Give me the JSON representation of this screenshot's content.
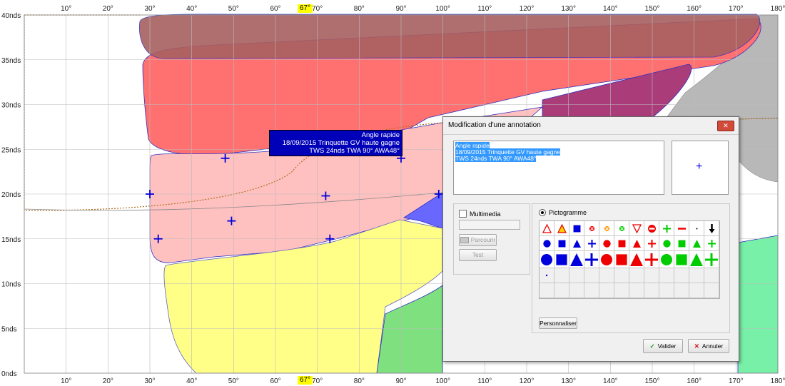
{
  "chart_data": {
    "type": "area",
    "x_ticks": [
      "10°",
      "20°",
      "30°",
      "40°",
      "50°",
      "60°",
      "70°",
      "80°",
      "90°",
      "100°",
      "110°",
      "120°",
      "130°",
      "140°",
      "150°",
      "160°",
      "170°",
      "180°"
    ],
    "y_ticks": [
      "0nds",
      "5nds",
      "10nds",
      "15nds",
      "20nds",
      "25nds",
      "30nds",
      "35nds",
      "40nds"
    ],
    "xlim": [
      0,
      180
    ],
    "ylim": [
      0,
      40
    ],
    "grid": true,
    "marker": {
      "label": "67°",
      "x": 67
    },
    "plus_points": [
      {
        "x": 48,
        "y": 24
      },
      {
        "x": 30,
        "y": 20
      },
      {
        "x": 72,
        "y": 19.8
      },
      {
        "x": 90,
        "y": 24
      },
      {
        "x": 49.5,
        "y": 17
      },
      {
        "x": 32,
        "y": 15
      },
      {
        "x": 73,
        "y": 15
      },
      {
        "x": 99,
        "y": 20
      }
    ],
    "colors": {
      "red": "#ff7070",
      "pink": "#ffc0c0",
      "yellow": "#ffff88",
      "green": "#78f0a8",
      "lime": "#7fe07f",
      "blue": "#6868ff",
      "purple": "#aa3c7a",
      "brown": "#a86060",
      "gray": "#b8b8b8"
    }
  },
  "tooltip": {
    "lines": [
      "Angle rapide",
      "18/09/2015 Trinquette GV haute gagne",
      "TWS 24nds TWA 90° AWA48°"
    ]
  },
  "dialog": {
    "title": "Modification d'une annotation",
    "close_label": "✕",
    "text_lines": [
      "Angle rapide",
      "18/09/2015 Trinquette GV haute gagne",
      "TWS 24nds TWA 90° AWA48°"
    ],
    "preview_symbol": "+",
    "multimedia_label": "Multimedia",
    "parcourir_label": "Parcourir",
    "test_label": "Test",
    "pictogramme_label": "Pictogramme",
    "personnaliser_label": "Personnaliser",
    "valider_label": "Valider",
    "annuler_label": "Annuler",
    "icons": {
      "row1": [
        "triangle-outline-red-icon",
        "triangle-orange-icon",
        "square-blue-icon",
        "circle-x-red-icon",
        "circle-x-orange-icon",
        "circle-x-green-icon",
        "triangle-down-red-icon",
        "no-entry-icon",
        "plus-green-icon",
        "minus-red-icon",
        "dot-small-icon",
        "arrow-down-black-icon"
      ],
      "row2": [
        "circle-blue-icon",
        "square-blue-icon",
        "triangle-blue-icon",
        "plus-blue-icon",
        "circle-red-icon",
        "square-red-icon",
        "triangle-red-icon",
        "plus-red-icon",
        "circle-green-icon",
        "square-green-icon",
        "triangle-green-icon",
        "plus-green-icon"
      ],
      "row3": [
        "circle-blue-icon",
        "square-blue-icon",
        "triangle-blue-icon",
        "plus-blue-icon",
        "circle-red-icon",
        "square-red-icon",
        "triangle-red-icon",
        "plus-red-icon",
        "circle-green-icon",
        "square-green-icon",
        "triangle-green-icon",
        "plus-green-icon"
      ]
    }
  }
}
